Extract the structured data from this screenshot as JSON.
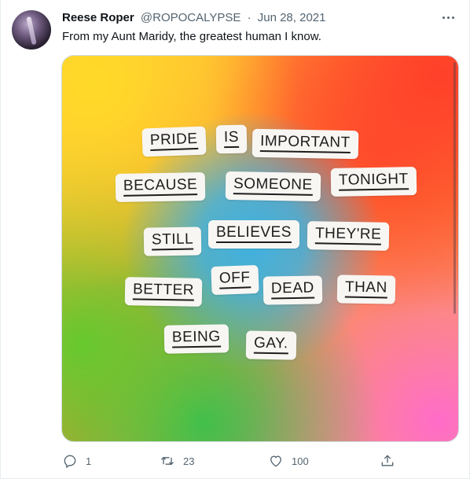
{
  "tweet": {
    "author_name": "Reese Roper",
    "author_handle": "@ROPOCALYPSE",
    "separator": "·",
    "date": "Jun 28, 2021",
    "text": "From my Aunt Maridy, the greatest human I know.",
    "more_icon": "more-horizontal-icon"
  },
  "media": {
    "words": [
      "PRIDE",
      "IS",
      "IMPORTANT",
      "BECAUSE",
      "SOMEONE",
      "TONIGHT",
      "STILL",
      "BELIEVES",
      "THEY'RE",
      "BETTER",
      "OFF",
      "DEAD",
      "THAN",
      "BEING",
      "GAY."
    ],
    "colors": {
      "yellow": "#ffd928",
      "red": "#ff3f2a",
      "green": "#66c92e",
      "blue": "#3db2e2",
      "pink": "#ff6cc8",
      "paper": "#f8f6f3"
    }
  },
  "actions": {
    "reply_count": "1",
    "retweet_count": "23",
    "like_count": "100",
    "reply_icon": "reply-icon",
    "retweet_icon": "retweet-icon",
    "like_icon": "heart-icon",
    "share_icon": "share-icon"
  }
}
